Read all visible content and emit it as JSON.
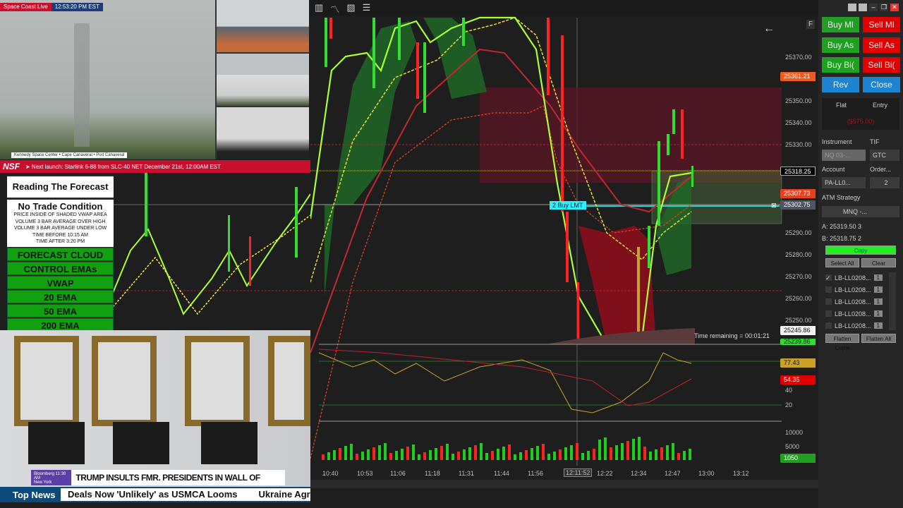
{
  "stream": {
    "channel": "Space Coast Live",
    "clock": "12:53:20 PM EST",
    "locations": "Kennedy Space Center  •  Cape Canaveral  •  Port Canaveral",
    "brand": "NSF",
    "next_launch": "➤ Next launch: Starlink 6-88 from SLC-40 NET December 21st, 12:00AM EST"
  },
  "forecast": {
    "title": "Reading The Forecast",
    "no_trade_title": "No Trade Condition",
    "conditions": [
      "PRICE INSIDE OF SHADED VWAP AREA",
      "VOLUME 3 BAR AVERAGE OVER HIGH",
      "VOLUME 3 BAR AVERAGE UNDER LOW",
      "TIME BEFORE 10:15 AM",
      "TIME AFTER 3:20 PM"
    ],
    "legend": [
      "FORECAST CLOUD",
      "CONTROL EMAs",
      "VWAP",
      "20 EMA",
      "50 EMA",
      "200 EMA"
    ]
  },
  "news": {
    "network": "Bloomberg 11:30 AM",
    "city": "New York",
    "headline": "TRUMP INSULTS FMR. PRESIDENTS IN WALL OF FAME PLAQUES",
    "section": "Top News",
    "ticker": [
      "Deals Now 'Unlikely' as USMCA Looms",
      "Ukraine Agrees to S"
    ]
  },
  "chart": {
    "price_ticks": [
      "25370.00",
      "25350.00",
      "25340.00",
      "25330.00",
      "25290.00",
      "25280.00",
      "25270.00",
      "25260.00",
      "25250.00"
    ],
    "price_flags": [
      {
        "v": "25361.21",
        "c": "#f05a1e"
      },
      {
        "v": "25318.25",
        "c": "#000000"
      },
      {
        "v": "25307.73",
        "c": "#e8401e"
      },
      {
        "v": "25302.75",
        "c": "#505560"
      },
      {
        "v": "25245.86",
        "c": "#f2f2f2"
      },
      {
        "v": "25239.86",
        "c": "#33dd33"
      }
    ],
    "order_label": "2 Buy LMT",
    "time_remaining": "Time remaining = 00:01:21",
    "f_label": "F",
    "osc_ticks": [
      "40",
      "20"
    ],
    "osc_flags": [
      {
        "v": "77.43",
        "c": "#c9a227"
      },
      {
        "v": "54.35",
        "c": "#e00000"
      }
    ],
    "vol_ticks": [
      "10000",
      "5000"
    ],
    "vol_flag": "1050",
    "time_ticks": [
      "10:40",
      "10:53",
      "11:06",
      "11:18",
      "11:31",
      "11:44",
      "11:56",
      "12:11:52",
      "12:22",
      "12:34",
      "12:47",
      "13:00",
      "13:12"
    ]
  },
  "panel": {
    "buttons": {
      "buy_mkt": "Buy Ml",
      "sell_mkt": "Sell Ml",
      "buy_ask": "Buy As",
      "sell_ask": "Sell As",
      "buy_bid": "Buy Bi(",
      "sell_bid": "Sell Bi(",
      "rev": "Rev",
      "close": "Close"
    },
    "flat": "Flat",
    "entry": "Entry",
    "pnl": "($575.00)",
    "instrument_label": "Instrument",
    "instrument": "NQ 03-...",
    "tif_label": "TIF",
    "tif": "GTC",
    "account_label": "Account",
    "account": "PA-LL0...",
    "order_label": "Order...",
    "order_qty": "2",
    "atm_label": "ATM Strategy",
    "atm": "MNQ -...",
    "ask": "A:  25319.50   3",
    "bid": "B:  25318.75   2",
    "copy": "Copy",
    "select_all": "Select All",
    "clear": "Clear",
    "accounts": [
      {
        "name": "LB-LL0208...",
        "qty": "1",
        "checked": true
      },
      {
        "name": "LB-LL0208...",
        "qty": "1",
        "checked": false
      },
      {
        "name": "LB-LL0208...",
        "qty": "1",
        "checked": false
      },
      {
        "name": "LB-LL0208...",
        "qty": "1",
        "checked": false
      },
      {
        "name": "LB-LL0208...",
        "qty": "1",
        "checked": false
      }
    ],
    "flatten_copies": "Flatten Copie",
    "flatten_all": "Flatten All"
  }
}
